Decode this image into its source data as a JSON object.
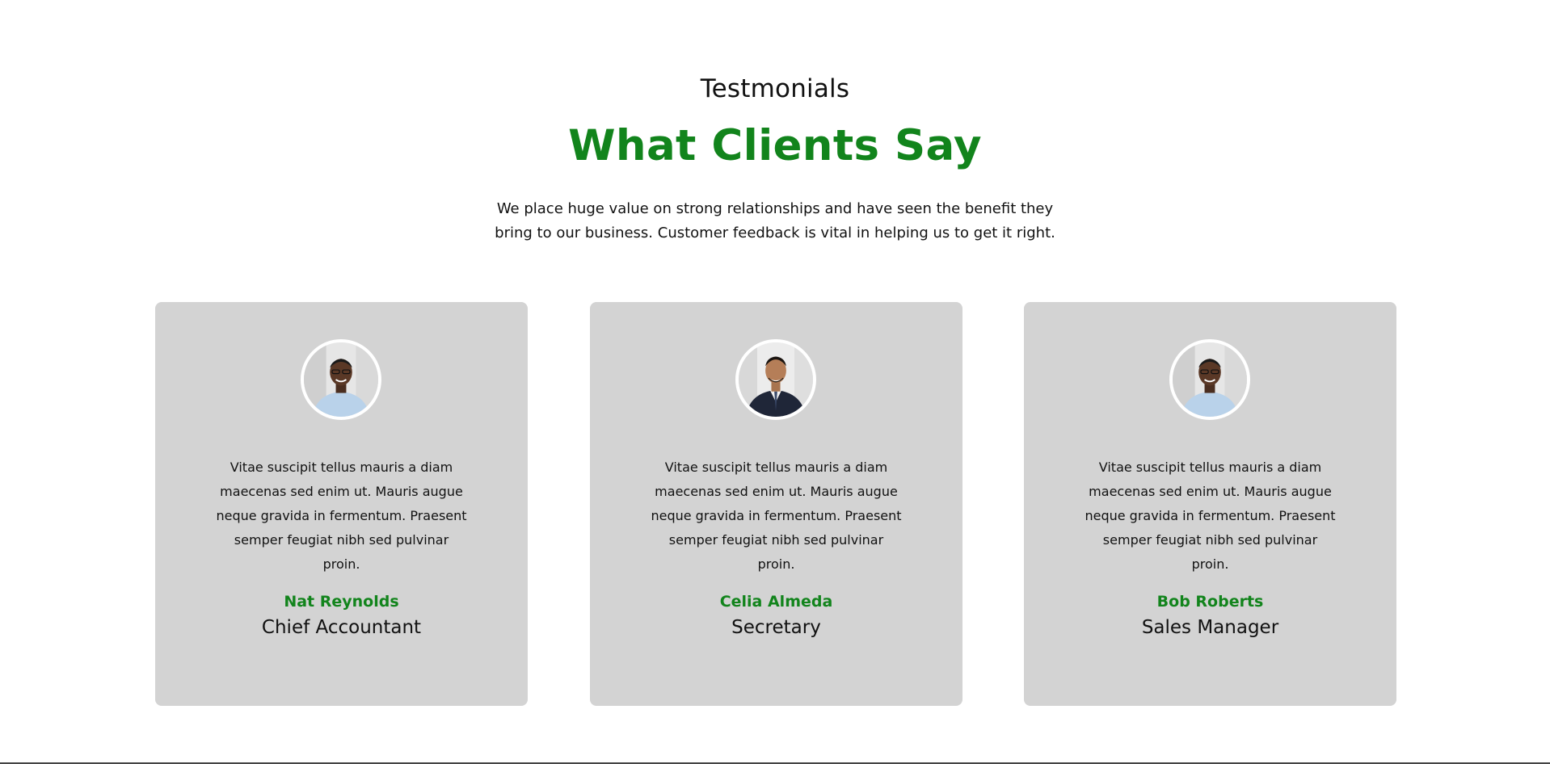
{
  "section": {
    "eyebrow": "Testmonials",
    "headline": "What Clients Say",
    "intro_lines": [
      "We place huge value on strong relationships and have seen the benefit they",
      "bring to our business. Customer feedback is vital in helping us to get it right."
    ]
  },
  "testimonials": [
    {
      "quote_lines": [
        "Vitae suscipit tellus mauris a diam",
        "maecenas sed enim ut. Mauris augue",
        "neque gravida in fermentum. Praesent",
        "semper feugiat nibh sed pulvinar",
        "proin."
      ],
      "name": "Nat Reynolds",
      "role": "Chief Accountant",
      "avatar": "person-photo-light-shirt"
    },
    {
      "quote_lines": [
        "Vitae suscipit tellus mauris a diam",
        "maecenas sed enim ut. Mauris augue",
        "neque gravida in fermentum. Praesent",
        "semper feugiat nibh sed pulvinar",
        "proin."
      ],
      "name": "Celia Almeda",
      "role": "Secretary",
      "avatar": "person-photo-dark-suit"
    },
    {
      "quote_lines": [
        "Vitae suscipit tellus mauris a diam",
        "maecenas sed enim ut. Mauris augue",
        "neque gravida in fermentum. Praesent",
        "semper feugiat nibh sed pulvinar",
        "proin."
      ],
      "name": "Bob Roberts",
      "role": "Sales Manager",
      "avatar": "person-photo-light-shirt"
    }
  ],
  "colors": {
    "accent": "#12841c",
    "card_bg": "#d3d3d3",
    "text": "#111111"
  }
}
